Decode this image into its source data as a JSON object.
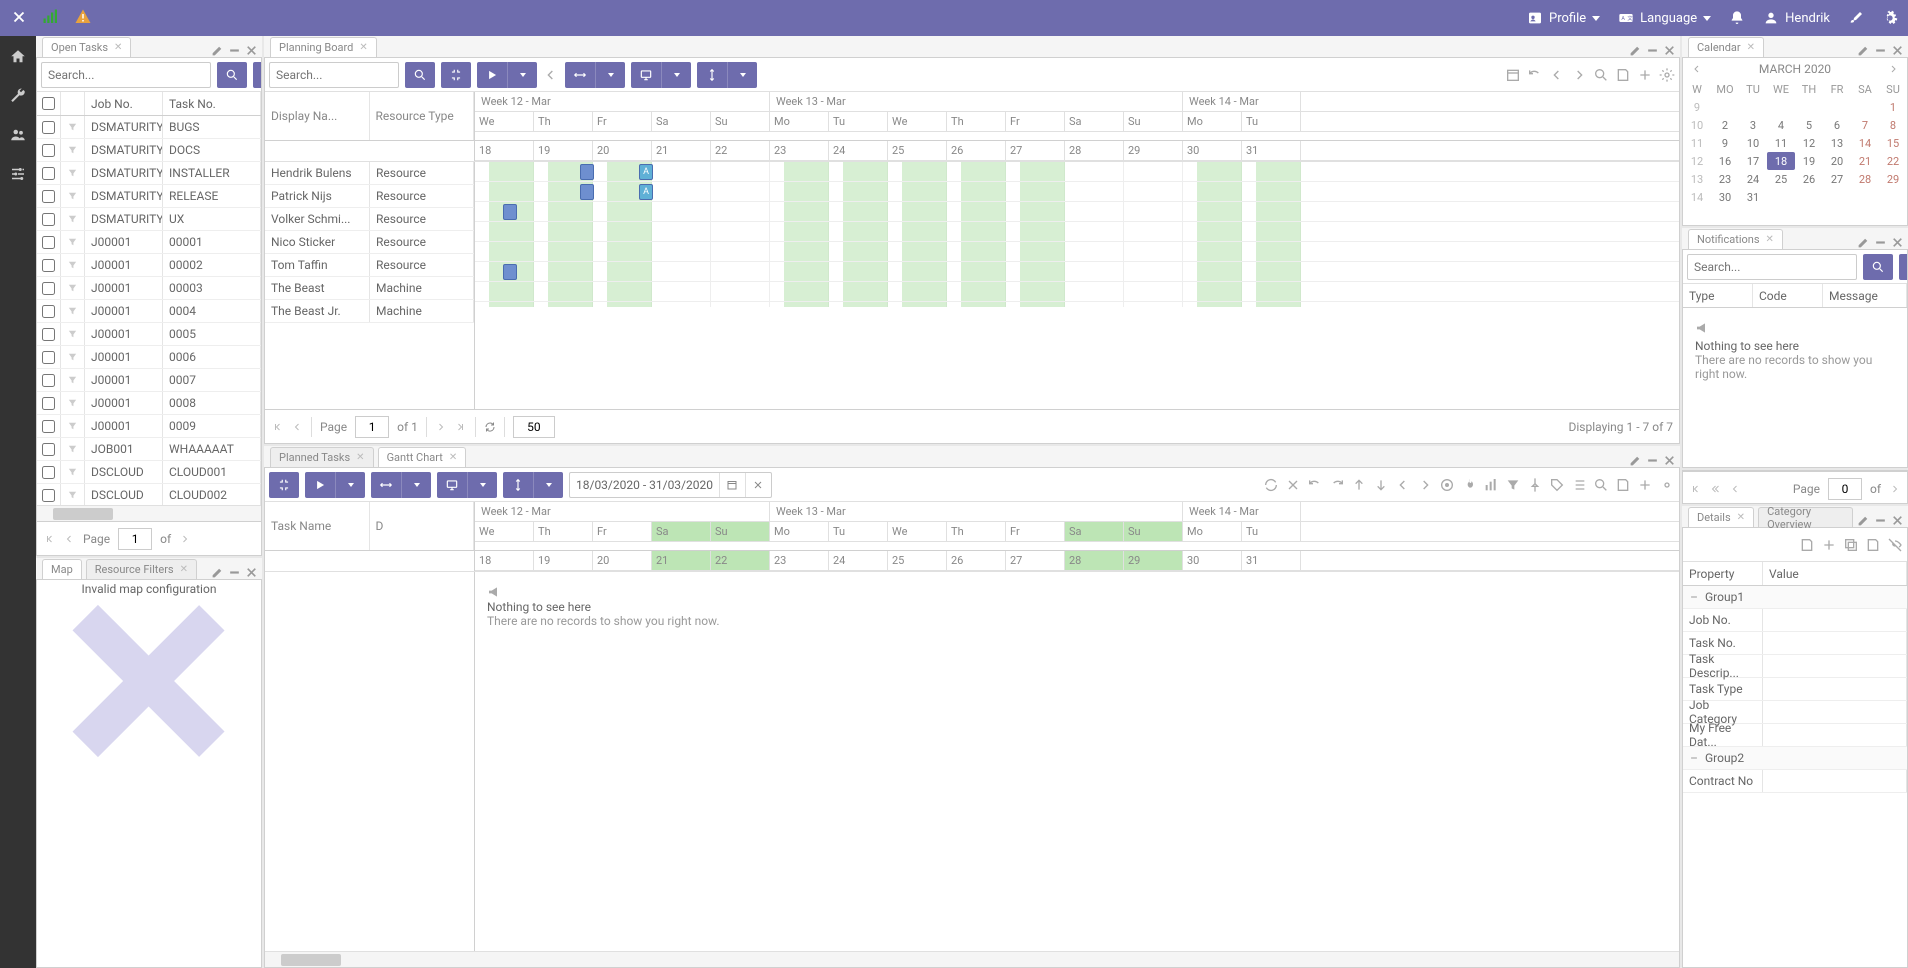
{
  "topbar": {
    "profile": "Profile",
    "language": "Language",
    "user": "Hendrik"
  },
  "tabs": {
    "open_tasks": "Open Tasks",
    "planning_board": "Planning Board",
    "calendar": "Calendar",
    "notifications": "Notifications",
    "map": "Map",
    "resource_filters": "Resource Filters",
    "planned_tasks": "Planned Tasks",
    "gantt_chart": "Gantt Chart",
    "details": "Details",
    "category_overview": "Category Overview"
  },
  "search_placeholder": "Search...",
  "open_tasks": {
    "cols": {
      "job": "Job No.",
      "task": "Task No."
    },
    "rows": [
      {
        "job": "DSMATURITY",
        "task": "BUGS"
      },
      {
        "job": "DSMATURITY",
        "task": "DOCS"
      },
      {
        "job": "DSMATURITY",
        "task": "INSTALLER"
      },
      {
        "job": "DSMATURITY",
        "task": "RELEASE"
      },
      {
        "job": "DSMATURITY",
        "task": "UX"
      },
      {
        "job": "J00001",
        "task": "00001"
      },
      {
        "job": "J00001",
        "task": "00002"
      },
      {
        "job": "J00001",
        "task": "00003"
      },
      {
        "job": "J00001",
        "task": "0004"
      },
      {
        "job": "J00001",
        "task": "0005"
      },
      {
        "job": "J00001",
        "task": "0006"
      },
      {
        "job": "J00001",
        "task": "0007"
      },
      {
        "job": "J00001",
        "task": "0008"
      },
      {
        "job": "J00001",
        "task": "0009"
      },
      {
        "job": "JOB001",
        "task": "WHAAAAAT"
      },
      {
        "job": "DSCLOUD",
        "task": "CLOUD001"
      },
      {
        "job": "DSCLOUD",
        "task": "CLOUD002"
      }
    ],
    "page_label": "Page",
    "page": "1",
    "of": "of"
  },
  "map": {
    "error": "Invalid map configuration"
  },
  "planning_board": {
    "left_cols": {
      "name": "Display Na...",
      "type": "Resource Type"
    },
    "resources": [
      {
        "name": "Hendrik Bulens",
        "type": "Resource"
      },
      {
        "name": "Patrick Nijs",
        "type": "Resource"
      },
      {
        "name": "Volker Schmi...",
        "type": "Resource"
      },
      {
        "name": "Nico Sticker",
        "type": "Resource"
      },
      {
        "name": "Tom Taffin",
        "type": "Resource"
      },
      {
        "name": "The Beast",
        "type": "Machine"
      },
      {
        "name": "The Beast Jr.",
        "type": "Machine"
      }
    ],
    "weeks": [
      "Week 12 - Mar",
      "Week 13 - Mar",
      "Week 14 - Mar"
    ],
    "days_abbr": [
      "We",
      "Th",
      "Fr",
      "Sa",
      "Su",
      "Mo",
      "Tu",
      "We",
      "Th",
      "Fr",
      "Sa",
      "Su",
      "Mo",
      "Tu"
    ],
    "days_num": [
      "18",
      "19",
      "20",
      "21",
      "22",
      "23",
      "24",
      "25",
      "26",
      "27",
      "28",
      "29",
      "30",
      "31"
    ],
    "paging": {
      "page_label": "Page",
      "page": "1",
      "of": "of 1",
      "pagesize": "50",
      "display": "Displaying 1 - 7 of 7"
    }
  },
  "gantt": {
    "date_range": "18/03/2020 - 31/03/2020",
    "task_name_col": "Task Name",
    "d_col": "D",
    "empty_title": "Nothing to see here",
    "empty_msg": "There are no records to show you right now."
  },
  "calendar": {
    "title": "MARCH 2020",
    "dow": [
      "W",
      "MO",
      "TU",
      "WE",
      "TH",
      "FR",
      "SA",
      "SU"
    ],
    "rows": [
      [
        "9",
        "",
        "",
        "",
        "",
        "",
        "",
        "1"
      ],
      [
        "10",
        "2",
        "3",
        "4",
        "5",
        "6",
        "7",
        "8"
      ],
      [
        "11",
        "9",
        "10",
        "11",
        "12",
        "13",
        "14",
        "15"
      ],
      [
        "12",
        "16",
        "17",
        "18",
        "19",
        "20",
        "21",
        "22"
      ],
      [
        "13",
        "23",
        "24",
        "25",
        "26",
        "27",
        "28",
        "29"
      ],
      [
        "14",
        "30",
        "31",
        "",
        "",
        "",
        "",
        ""
      ]
    ]
  },
  "notifications": {
    "cols": {
      "type": "Type",
      "code": "Code",
      "message": "Message"
    },
    "empty_title": "Nothing to see here",
    "empty_msg": "There are no records to show you right now."
  },
  "details": {
    "cols": {
      "prop": "Property",
      "val": "Value"
    },
    "group1": "Group1",
    "group2": "Group2",
    "props1": [
      "Job No.",
      "Task No.",
      "Task Descrip...",
      "Task Type",
      "Job Category",
      "My Free Dat..."
    ],
    "props2": [
      "Contract No"
    ]
  },
  "details_paging": {
    "page_label": "Page",
    "page": "0",
    "of": "of"
  }
}
